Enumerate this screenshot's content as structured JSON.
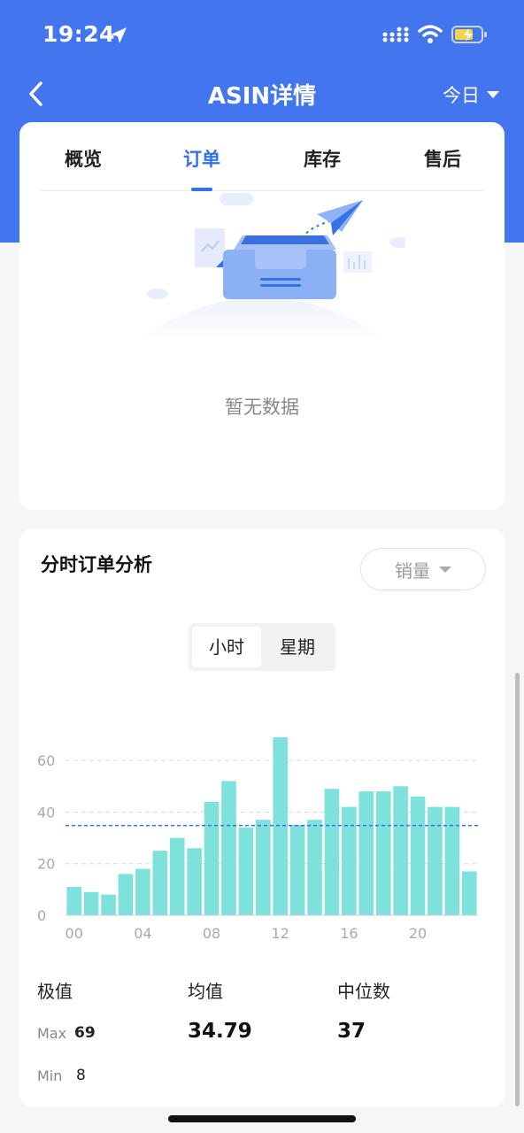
{
  "status_bar": {
    "time": "19:24"
  },
  "nav": {
    "title": "ASIN详情",
    "date_filter": "今日"
  },
  "tabs": [
    {
      "label": "概览"
    },
    {
      "label": "订单"
    },
    {
      "label": "库存"
    },
    {
      "label": "售后"
    }
  ],
  "active_tab": "订单",
  "empty_state": {
    "text": "暂无数据"
  },
  "hourly": {
    "title": "分时订单分析",
    "metric_select": "销量",
    "segments": [
      {
        "label": "小时"
      },
      {
        "label": "星期"
      }
    ],
    "selected_segment": "小时",
    "stats": {
      "extreme_label": "极值",
      "mean_label": "均值",
      "median_label": "中位数",
      "max_label": "Max",
      "max_value": "69",
      "min_label": "Min",
      "min_value": "8",
      "mean_value": "34.79",
      "median_value": "37"
    }
  },
  "chart_data": {
    "type": "bar",
    "categories": [
      "00",
      "01",
      "02",
      "03",
      "04",
      "05",
      "06",
      "07",
      "08",
      "09",
      "10",
      "11",
      "12",
      "13",
      "14",
      "15",
      "16",
      "17",
      "18",
      "19",
      "20",
      "21",
      "22",
      "23"
    ],
    "x_tick_labels": [
      "00",
      "04",
      "08",
      "12",
      "16",
      "20"
    ],
    "values": [
      11,
      9,
      8,
      16,
      18,
      25,
      30,
      26,
      44,
      52,
      34,
      37,
      69,
      35,
      37,
      49,
      42,
      48,
      48,
      50,
      46,
      42,
      42,
      17
    ],
    "y_ticks": [
      0,
      20,
      40,
      60
    ],
    "ylim": [
      0,
      70
    ],
    "mean_line": 34.79,
    "bar_color": "#7ee1dc",
    "mean_line_color": "#3472e8",
    "grid": "dashed horizontal"
  },
  "colors": {
    "brand_blue": "#4275ee",
    "accent_blue": "#3472e8"
  }
}
